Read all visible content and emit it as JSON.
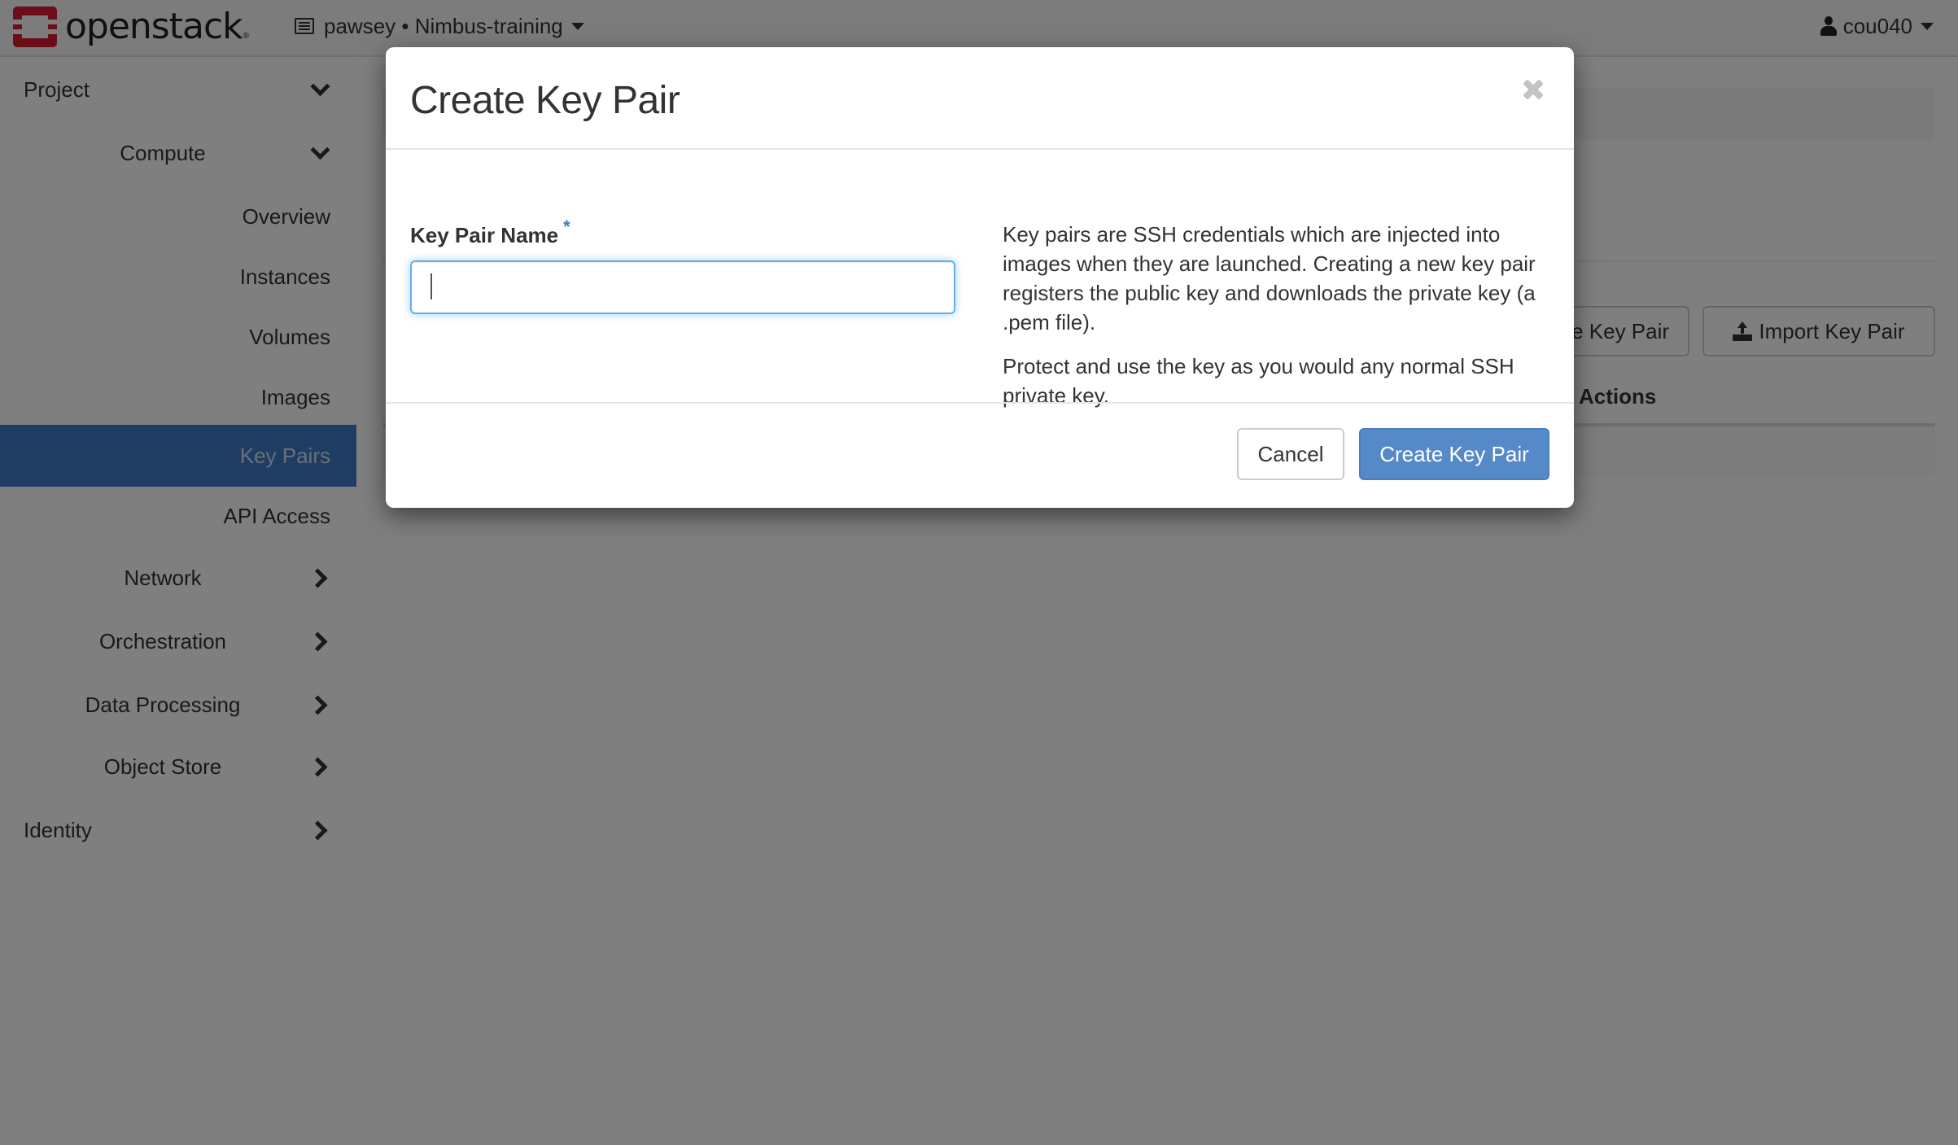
{
  "topbar": {
    "brand": "openstack",
    "brand_mark": "®",
    "project_selector": "pawsey • Nimbus-training",
    "user": "cou040"
  },
  "sidebar": {
    "items": [
      {
        "label": "Project",
        "level": 0,
        "icon": "chevron-down-icon"
      },
      {
        "label": "Compute",
        "level": 1,
        "icon": "chevron-down-icon"
      },
      {
        "label": "Overview",
        "level": 2
      },
      {
        "label": "Instances",
        "level": 2
      },
      {
        "label": "Volumes",
        "level": 2
      },
      {
        "label": "Images",
        "level": 2
      },
      {
        "label": "Key Pairs",
        "level": 2,
        "active": true
      },
      {
        "label": "API Access",
        "level": 2
      },
      {
        "label": "Network",
        "level": 1,
        "icon": "chevron-right-icon"
      },
      {
        "label": "Orchestration",
        "level": 1,
        "icon": "chevron-right-icon"
      },
      {
        "label": "Data Processing",
        "level": 1,
        "icon": "chevron-right-icon"
      },
      {
        "label": "Object Store",
        "level": 1,
        "icon": "chevron-right-icon"
      },
      {
        "label": "Identity",
        "level": 0,
        "icon": "chevron-right-icon"
      }
    ]
  },
  "main": {
    "create_button_partial": "eate Key Pair",
    "import_button": "Import Key Pair",
    "table_columns": [
      "Actions"
    ]
  },
  "modal": {
    "title": "Create Key Pair",
    "field_label": "Key Pair Name",
    "required_marker": "*",
    "field_value": "",
    "help_paragraphs": [
      "Key pairs are SSH credentials which are injected into images when they are launched. Creating a new key pair registers the public key and downloads the private key (a .pem file).",
      "Protect and use the key as you would any normal SSH private key."
    ],
    "cancel_label": "Cancel",
    "submit_label": "Create Key Pair"
  },
  "colors": {
    "brand_red": "#da1a32",
    "primary": "#5689c7",
    "active_nav": "#3e7bc7",
    "focus_ring": "#66afe9"
  }
}
